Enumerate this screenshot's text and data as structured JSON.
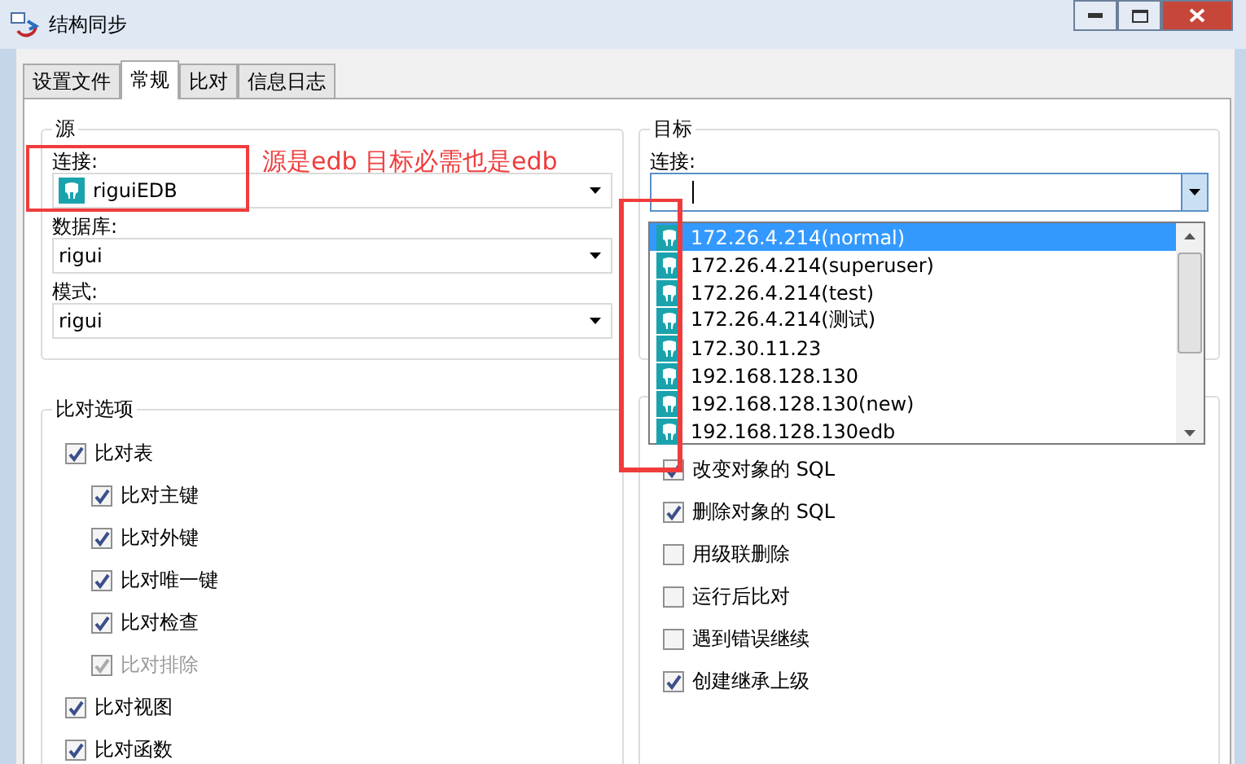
{
  "window": {
    "title": "结构同步"
  },
  "tabs": [
    {
      "label": "设置文件",
      "selected": false
    },
    {
      "label": "常规",
      "selected": true
    },
    {
      "label": "比对",
      "selected": false
    },
    {
      "label": "信息日志",
      "selected": false
    }
  ],
  "source": {
    "title": "源",
    "fields": [
      {
        "label": "连接:",
        "value": "riguiEDB",
        "kind": "connection"
      },
      {
        "label": "数据库:",
        "value": "rigui",
        "kind": "plain"
      },
      {
        "label": "模式:",
        "value": "rigui",
        "kind": "plain"
      }
    ]
  },
  "target": {
    "title": "目标",
    "label": "连接:",
    "dropdown": [
      {
        "label": "172.26.4.214(normal)",
        "selected": true
      },
      {
        "label": "172.26.4.214(superuser)",
        "selected": false
      },
      {
        "label": "172.26.4.214(test)",
        "selected": false
      },
      {
        "label": "172.26.4.214(测试)",
        "selected": false
      },
      {
        "label": "172.30.11.23",
        "selected": false
      },
      {
        "label": "192.168.128.130",
        "selected": false
      },
      {
        "label": "192.168.128.130(new)",
        "selected": false
      },
      {
        "label": "192.168.128.130edb",
        "selected": false
      }
    ]
  },
  "compare_options": {
    "title": "比对选项",
    "items": [
      {
        "label": "比对表",
        "checked": true,
        "disabled": false,
        "children": [
          {
            "label": "比对主键",
            "checked": true,
            "disabled": false
          },
          {
            "label": "比对外键",
            "checked": true,
            "disabled": false
          },
          {
            "label": "比对唯一键",
            "checked": true,
            "disabled": false
          },
          {
            "label": "比对检查",
            "checked": true,
            "disabled": false
          },
          {
            "label": "比对排除",
            "checked": true,
            "disabled": true
          }
        ]
      },
      {
        "label": "比对视图",
        "checked": true,
        "disabled": false
      },
      {
        "label": "比对函数",
        "checked": true,
        "disabled": false
      }
    ]
  },
  "script_options": {
    "items": [
      {
        "label": "改变对象的 SQL",
        "checked": true
      },
      {
        "label": "删除对象的 SQL",
        "checked": true
      },
      {
        "label": "用级联删除",
        "checked": false
      },
      {
        "label": "运行后比对",
        "checked": false
      },
      {
        "label": "遇到错误继续",
        "checked": false
      },
      {
        "label": "创建继承上级",
        "checked": true
      }
    ]
  },
  "annotation": {
    "text": "源是edb  目标必需也是edb"
  }
}
